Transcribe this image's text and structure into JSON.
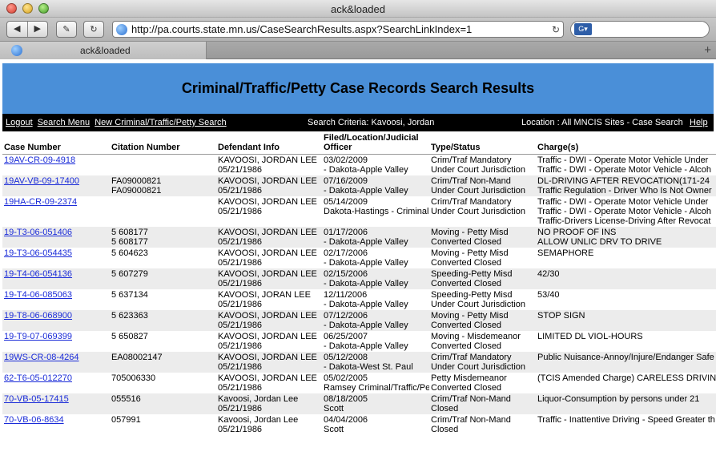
{
  "window": {
    "title": "ack&loaded"
  },
  "toolbar": {
    "back_label": "◀",
    "forward_label": "▶",
    "edit_label": "✎",
    "reload_label": "↻",
    "url": "http://pa.courts.state.mn.us/CaseSearchResults.aspx?SearchLinkIndex=1",
    "url_reload": "↻",
    "search_engine_icon": "google-icon",
    "search_value": ""
  },
  "tabs": [
    {
      "label": "ack&loaded"
    }
  ],
  "tabbar": {
    "new_tab": "+"
  },
  "page": {
    "title": "Criminal/Traffic/Petty Case Records Search Results",
    "nav": {
      "logout": "Logout",
      "search_menu": "Search Menu",
      "new_search": "New Criminal/Traffic/Petty Search",
      "criteria": "Search Criteria: Kavoosi, Jordan",
      "location": "Location : All MNCIS Sites - Case Search",
      "help": "Help"
    },
    "columns": [
      "Case Number",
      "Citation Number",
      "Defendant Info",
      "Filed/Location/Judicial Officer",
      "Type/Status",
      "Charge(s)"
    ],
    "rows": [
      {
        "case": "19AV-CR-09-4918",
        "citation": [
          ""
        ],
        "defendant": [
          "KAVOOSI, JORDAN LEE",
          "05/21/1986"
        ],
        "filed": [
          "03/02/2009",
          "- Dakota-Apple Valley"
        ],
        "type": [
          "Crim/Traf Mandatory",
          "Under Court Jurisdiction"
        ],
        "charges": [
          "Traffic - DWI - Operate Motor Vehicle Under",
          "Traffic - DWI - Operate Motor Vehicle - Alcoh"
        ]
      },
      {
        "case": "19AV-VB-09-17400",
        "citation": [
          "FA09000821",
          "FA09000821"
        ],
        "defendant": [
          "KAVOOSI, JORDAN LEE",
          "05/21/1986"
        ],
        "filed": [
          "07/16/2009",
          "- Dakota-Apple Valley"
        ],
        "type": [
          "Crim/Traf Non-Mand",
          "Under Court Jurisdiction"
        ],
        "charges": [
          "DL-DRIVING AFTER REVOCATION(171-24",
          "Traffic Regulation - Driver Who Is Not Owner"
        ]
      },
      {
        "case": "19HA-CR-09-2374",
        "citation": [
          ""
        ],
        "defendant": [
          "KAVOOSI, JORDAN LEE",
          "05/21/1986"
        ],
        "filed": [
          "05/14/2009",
          "Dakota-Hastings - Criminal"
        ],
        "type": [
          "Crim/Traf Mandatory",
          "Under Court Jurisdiction"
        ],
        "charges": [
          "Traffic - DWI - Operate Motor Vehicle Under",
          "Traffic - DWI - Operate Motor Vehicle - Alcoh",
          "Traffic-Drivers License-Driving After Revocat"
        ]
      },
      {
        "case": "19-T3-06-051406",
        "citation": [
          "5 608177",
          "5 608177"
        ],
        "defendant": [
          "KAVOOSI, JORDAN LEE",
          "05/21/1986"
        ],
        "filed": [
          "01/17/2006",
          "- Dakota-Apple Valley"
        ],
        "type": [
          "Moving - Petty Misd",
          "Converted Closed"
        ],
        "charges": [
          "NO PROOF OF INS",
          "ALLOW UNLIC DRV TO DRIVE"
        ]
      },
      {
        "case": "19-T3-06-054435",
        "citation": [
          "5 604623"
        ],
        "defendant": [
          "KAVOOSI, JORDAN LEE",
          "05/21/1986"
        ],
        "filed": [
          "02/17/2006",
          "- Dakota-Apple Valley"
        ],
        "type": [
          "Moving - Petty Misd",
          "Converted Closed"
        ],
        "charges": [
          "SEMAPHORE"
        ]
      },
      {
        "case": "19-T4-06-054136",
        "citation": [
          "5 607279"
        ],
        "defendant": [
          "KAVOOSI, JORDAN LEE",
          "05/21/1986"
        ],
        "filed": [
          "02/15/2006",
          "- Dakota-Apple Valley"
        ],
        "type": [
          "Speeding-Petty Misd",
          "Converted Closed"
        ],
        "charges": [
          "42/30"
        ]
      },
      {
        "case": "19-T4-06-085063",
        "citation": [
          "5 637134"
        ],
        "defendant": [
          "KAVOOSI, JORAN LEE",
          "05/21/1986"
        ],
        "filed": [
          "12/11/2006",
          "- Dakota-Apple Valley"
        ],
        "type": [
          "Speeding-Petty Misd",
          "Under Court Jurisdiction"
        ],
        "charges": [
          "53/40"
        ]
      },
      {
        "case": "19-T8-06-068900",
        "citation": [
          "5 623363"
        ],
        "defendant": [
          "KAVOOSI, JORDAN LEE",
          "05/21/1986"
        ],
        "filed": [
          "07/12/2006",
          "- Dakota-Apple Valley"
        ],
        "type": [
          "Moving - Petty Misd",
          "Converted Closed"
        ],
        "charges": [
          "STOP SIGN"
        ]
      },
      {
        "case": "19-T9-07-069399",
        "citation": [
          "5 650827"
        ],
        "defendant": [
          "KAVOOSI, JORDAN LEE",
          "05/21/1986"
        ],
        "filed": [
          "06/25/2007",
          "- Dakota-Apple Valley"
        ],
        "type": [
          "Moving - Misdemeanor",
          "Converted Closed"
        ],
        "charges": [
          "LIMITED DL VIOL-HOURS"
        ]
      },
      {
        "case": "19WS-CR-08-4264",
        "citation": [
          "EA08002147"
        ],
        "defendant": [
          "KAVOOSI, JORDAN LEE",
          "05/21/1986"
        ],
        "filed": [
          "05/12/2008",
          "- Dakota-West St. Paul"
        ],
        "type": [
          "Crim/Traf Mandatory",
          "Under Court Jurisdiction"
        ],
        "charges": [
          "Public Nuisance-Annoy/Injure/Endanger Safe"
        ]
      },
      {
        "case": "62-T6-05-012270",
        "citation": [
          "705006330"
        ],
        "defendant": [
          "KAVOOSI, JORDAN LEE",
          "05/21/1986"
        ],
        "filed": [
          "05/02/2005",
          "Ramsey Criminal/Traffic/Petty"
        ],
        "type": [
          "Petty Misdemeanor",
          "Converted Closed"
        ],
        "charges": [
          "(TCIS Amended Charge) CARELESS DRIVIN"
        ]
      },
      {
        "case": "70-VB-05-17415",
        "citation": [
          "055516"
        ],
        "defendant": [
          "Kavoosi, Jordan Lee",
          "05/21/1986"
        ],
        "filed": [
          "08/18/2005",
          "Scott"
        ],
        "type": [
          "Crim/Traf Non-Mand",
          "Closed"
        ],
        "charges": [
          "Liquor-Consumption by persons under 21"
        ]
      },
      {
        "case": "70-VB-06-8634",
        "citation": [
          "057991"
        ],
        "defendant": [
          "Kavoosi, Jordan Lee",
          "05/21/1986"
        ],
        "filed": [
          "04/04/2006",
          "Scott"
        ],
        "type": [
          "Crim/Traf Non-Mand",
          "Closed"
        ],
        "charges": [
          "Traffic - Inattentive Driving - Speed Greater th"
        ]
      }
    ]
  },
  "colors": {
    "banner": "#4a8fd8",
    "navbar": "#000000",
    "link": "#1a2bd8",
    "alt_row": "#ececec"
  }
}
